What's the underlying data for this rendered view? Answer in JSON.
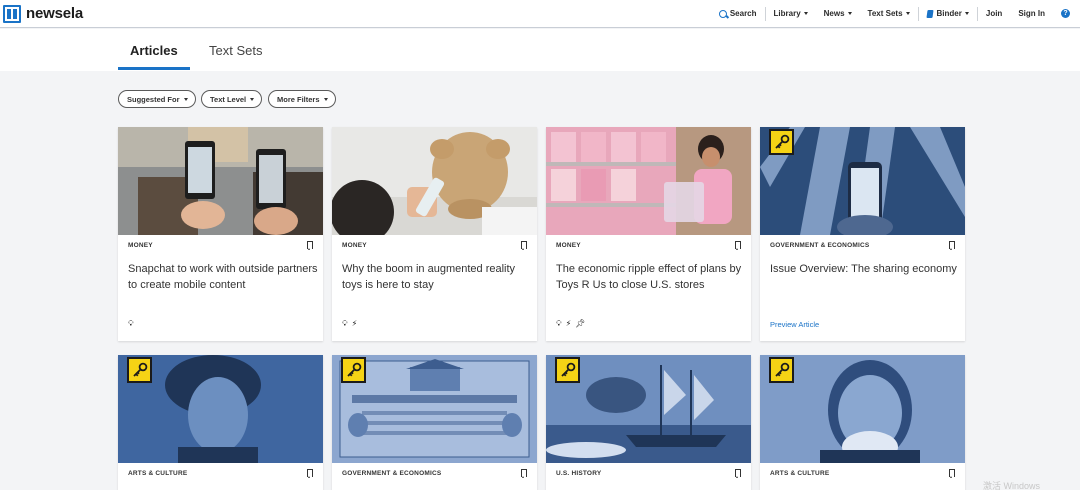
{
  "brand": {
    "name": "newsela"
  },
  "nav": {
    "search": "Search",
    "library": "Library",
    "news": "News",
    "text_sets": "Text Sets",
    "binder": "Binder",
    "join": "Join",
    "sign_in": "Sign In",
    "help": "?"
  },
  "tabs": [
    {
      "label": "Articles",
      "active": true
    },
    {
      "label": "Text Sets",
      "active": false
    }
  ],
  "filters": [
    "Suggested For",
    "Text Level",
    "More Filters"
  ],
  "cards": [
    {
      "category": "MONEY",
      "title": "Snapchat to work with outside partners to create mobile content",
      "icons": [
        "lightbulb-icon"
      ],
      "locked": false
    },
    {
      "category": "MONEY",
      "title": "Why the boom in augmented reality toys is here to stay",
      "icons": [
        "lightbulb-icon",
        "lightning-icon"
      ],
      "locked": false
    },
    {
      "category": "MONEY",
      "title": "The economic ripple effect of plans by Toys R Us to close U.S. stores",
      "icons": [
        "lightbulb-icon",
        "lightning-icon",
        "pin-icon"
      ],
      "locked": false
    },
    {
      "category": "GOVERNMENT & ECONOMICS",
      "title": "Issue Overview: The sharing economy",
      "preview": "Preview Article",
      "locked": true
    },
    {
      "category": "ARTS & CULTURE",
      "locked": true
    },
    {
      "category": "GOVERNMENT & ECONOMICS",
      "locked": true
    },
    {
      "category": "U.S. HISTORY",
      "locked": true
    },
    {
      "category": "ARTS & CULTURE",
      "locked": true
    }
  ],
  "watermark": "激活 Windows",
  "colors": {
    "accent": "#1a73c7",
    "key_badge": "#f5d315",
    "page_bg": "#f3f4f6"
  }
}
